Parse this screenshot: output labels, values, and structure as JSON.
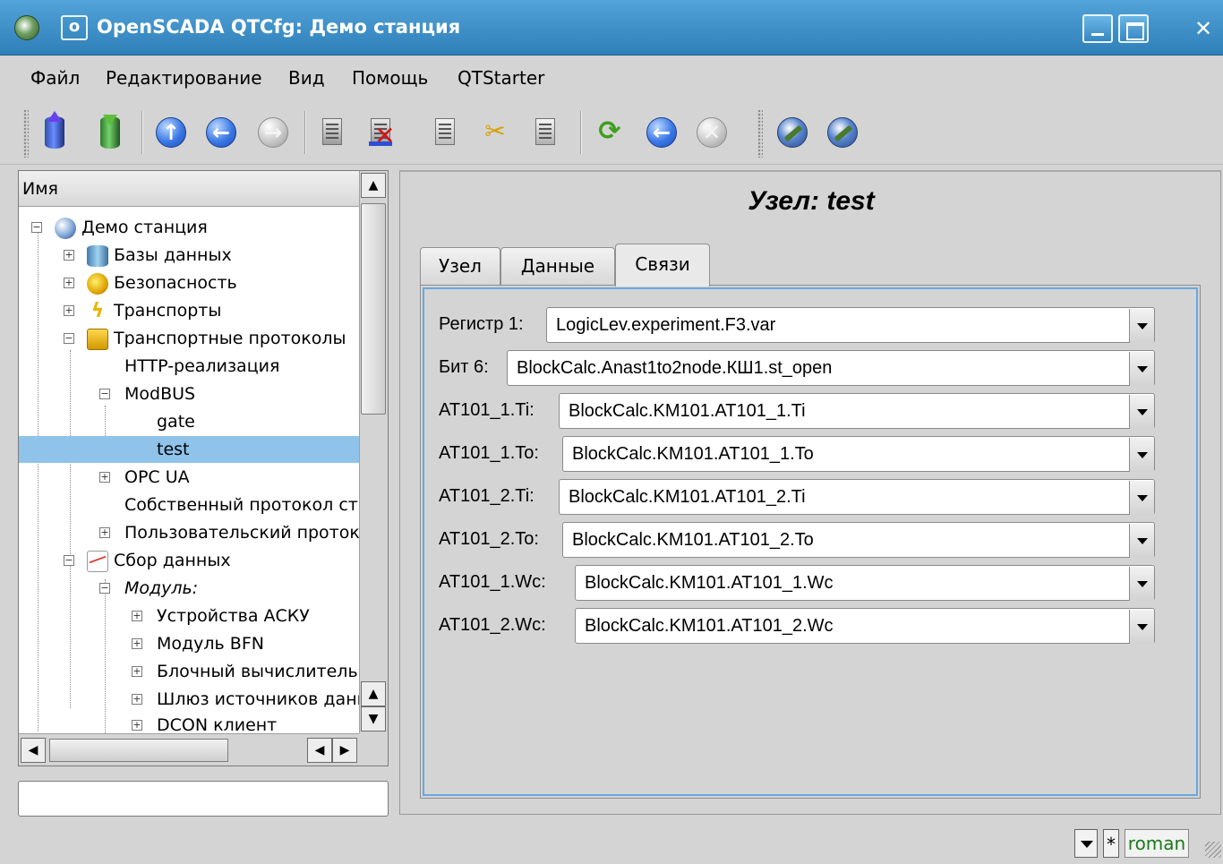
{
  "window": {
    "title": "OpenSCADA QTCfg: Демо станция",
    "pin_label": "o",
    "close_label": "✕"
  },
  "menu": [
    {
      "label": "Файл"
    },
    {
      "label": "Редактирование"
    },
    {
      "label": "Вид"
    },
    {
      "label": "Помощь"
    },
    {
      "label": "QTStarter"
    }
  ],
  "toolbar": {
    "icons": [
      "db-load-icon",
      "db-save-icon",
      "up-icon",
      "back-icon",
      "forward-icon",
      "add-item-icon",
      "delete-item-icon",
      "copy-icon",
      "cut-icon",
      "paste-icon",
      "refresh-icon",
      "start-icon",
      "stop-icon",
      "station-tool-icon",
      "station-config-icon"
    ]
  },
  "tree": {
    "header": "Имя",
    "items": [
      {
        "label": "Демо станция",
        "level": 0,
        "expander": "−",
        "icon": "station-icon"
      },
      {
        "label": "Базы данных",
        "level": 1,
        "expander": "+",
        "icon": "database-icon"
      },
      {
        "label": "Безопасность",
        "level": 1,
        "expander": "+",
        "icon": "security-icon"
      },
      {
        "label": "Транспорты",
        "level": 1,
        "expander": "+",
        "icon": "transport-icon"
      },
      {
        "label": "Транспортные протоколы",
        "level": 1,
        "expander": "−",
        "icon": "protocol-folder-icon"
      },
      {
        "label": "HTTP-реализация",
        "level": 2,
        "expander": ""
      },
      {
        "label": "ModBUS",
        "level": 2,
        "expander": "−"
      },
      {
        "label": "gate",
        "level": 3,
        "expander": ""
      },
      {
        "label": "test",
        "level": 3,
        "expander": "",
        "selected": true
      },
      {
        "label": "OPC UA",
        "level": 2,
        "expander": "+"
      },
      {
        "label": "Собственный протокол станции",
        "level": 2,
        "expander": ""
      },
      {
        "label": "Пользовательский протокол",
        "level": 2,
        "expander": "+"
      },
      {
        "label": "Сбор данных",
        "level": 1,
        "expander": "−",
        "icon": "data-acquisition-icon"
      },
      {
        "label": "Модуль:",
        "level": 2,
        "expander": "−",
        "italic": true
      },
      {
        "label": "Устройства АСКУ",
        "level": 3,
        "expander": "+"
      },
      {
        "label": "Модуль BFN",
        "level": 3,
        "expander": "+"
      },
      {
        "label": "Блочный вычислитель",
        "level": 3,
        "expander": "+"
      },
      {
        "label": "Шлюз источников данных",
        "level": 3,
        "expander": "+"
      },
      {
        "label": "DCON клиент",
        "level": 3,
        "expander": "+"
      }
    ]
  },
  "main": {
    "title": "Узел: test",
    "tabs": [
      {
        "label": "Узел"
      },
      {
        "label": "Данные"
      },
      {
        "label": "Связи",
        "active": true
      }
    ],
    "links": [
      {
        "label": "Регистр 1:",
        "value": "LogicLev.experiment.F3.var"
      },
      {
        "label": "Бит 6:",
        "value": "BlockCalc.Anast1to2node.КШ1.st_open"
      },
      {
        "label": "AT101_1.Ti:",
        "value": "BlockCalc.KM101.AT101_1.Ti"
      },
      {
        "label": "AT101_1.To:",
        "value": "BlockCalc.KM101.AT101_1.To"
      },
      {
        "label": "AT101_2.Ti:",
        "value": "BlockCalc.KM101.AT101_2.Ti"
      },
      {
        "label": "AT101_2.To:",
        "value": "BlockCalc.KM101.AT101_2.To"
      },
      {
        "label": "AT101_1.Wc:",
        "value": "BlockCalc.KM101.AT101_1.Wc"
      },
      {
        "label": "AT101_2.Wc:",
        "value": "BlockCalc.KM101.AT101_2.Wc"
      }
    ]
  },
  "status": {
    "star": "*",
    "user": "roman",
    "user_color": "#1a7a1a"
  },
  "colors": {
    "titlebar": "#3f8fc9",
    "selection": "#8fc3ea",
    "focus_frame": "#67a8e2"
  }
}
